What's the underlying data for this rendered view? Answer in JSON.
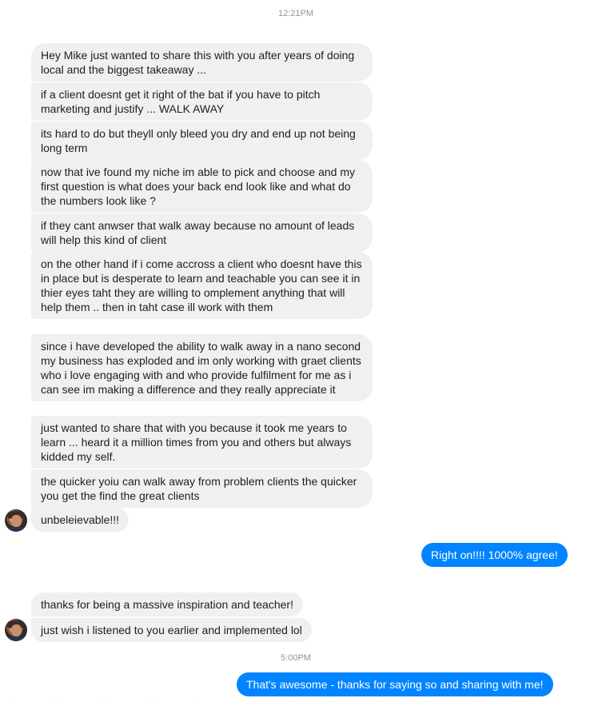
{
  "timestamps": {
    "first": "12:21PM",
    "second": "5:00PM"
  },
  "messages": {
    "m1": "Hey Mike just wanted to share this with you after years of doing local and the biggest takeaway ...",
    "m2": "if a client doesnt get it right of the bat if you have to pitch marketing and justify ... WALK AWAY",
    "m3": "its hard to do but theyll only bleed you dry and end up not being long term",
    "m4": "now that ive found my niche im able to pick and choose and my first question is what does your back end look like and what do the numbers look like  ?",
    "m5": "if they cant anwser that walk away because no amount of leads will help this kind of client",
    "m6": "on the other hand if i come accross a client who doesnt have this in place but is desperate to learn and teachable you can see it in thier eyes taht they are willing to omplement anything that will help them .. then in taht case ill work with them",
    "m7": "since i have developed the ability to walk away in a nano second my business has exploded and im only working with graet clients who i love engaging with and who provide fulfilment for me as i can see im making a difference and they really appreciate it",
    "m8": "just wanted to share that with you because it took me years to learn ... heard it a million times from you and others but always kidded my self.",
    "m9": "the quicker yoiu can walk away from problem clients the quicker you get the find the great clients",
    "m10": "unbeleievable!!!",
    "reply1": "Right on!!!! 1000% agree!",
    "m11": "thanks for being a massive inspiration and teacher!",
    "m12": "just wish i listened to you earlier and implemented lol",
    "reply2": "That's awesome - thanks for saying so and sharing with me!"
  },
  "colors": {
    "incoming_bubble": "#f1f0f0",
    "outgoing_bubble": "#0084ff",
    "timestamp": "#8d949e"
  },
  "icons": {
    "avatar": "contact-avatar"
  }
}
